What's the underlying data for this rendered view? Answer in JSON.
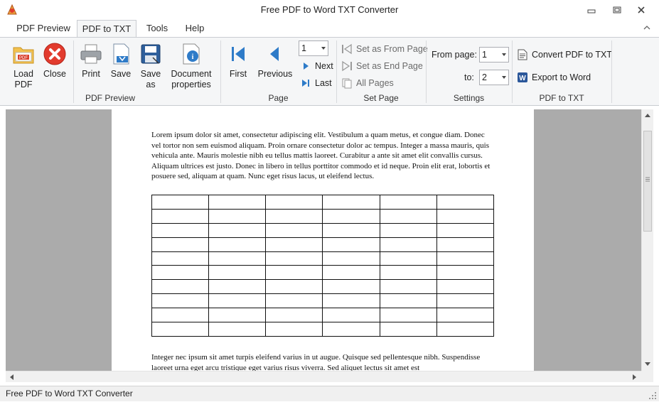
{
  "window": {
    "title": "Free PDF to Word TXT Converter"
  },
  "tabs": [
    {
      "label": "PDF Preview"
    },
    {
      "label": "PDF to TXT"
    },
    {
      "label": "Tools"
    },
    {
      "label": "Help"
    }
  ],
  "active_tab": "PDF to TXT",
  "ribbon": {
    "pdf_preview_group": {
      "label": "PDF Preview",
      "load": {
        "line1": "Load",
        "line2": "PDF"
      },
      "close": "Close",
      "print": "Print",
      "save": "Save",
      "save_as": {
        "line1": "Save",
        "line2": "as"
      },
      "doc_props": {
        "line1": "Document",
        "line2": "properties"
      }
    },
    "page_group": {
      "label": "Page",
      "first": "First",
      "previous": "Previous",
      "page_value": "1",
      "next": "Next",
      "last": "Last"
    },
    "set_page_group": {
      "label": "Set Page",
      "set_from": "Set as From Page",
      "set_end": "Set as End Page",
      "all_pages": "All Pages"
    },
    "settings_group": {
      "label": "Settings",
      "from_label": "From page:",
      "from_value": "1",
      "to_label": "to:",
      "to_value": "2"
    },
    "pdf_to_txt_group": {
      "label": "PDF to TXT",
      "convert": "Convert PDF to TXT",
      "export": "Export to Word"
    }
  },
  "document": {
    "paragraph1": "Lorem ipsum dolor sit amet, consectetur adipiscing elit. Vestibulum a quam metus, et congue diam. Donec vel tortor non sem euismod aliquam. Proin ornare consectetur dolor ac tempus. Integer a massa mauris, quis vehicula ante. Mauris molestie nibh eu tellus mattis laoreet. Curabitur a ante sit amet elit convallis cursus. Aliquam ultrices est justo. Donec in libero in tellus porttitor commodo et id neque. Proin elit erat, lobortis et posuere sed, aliquam at quam. Nunc eget risus lacus, ut eleifend lectus.",
    "table": {
      "rows": 10,
      "cols": 6
    },
    "paragraph2": "Integer nec ipsum sit amet turpis eleifend varius in ut augue. Quisque sed pellentesque nibh. Suspendisse laoreet urna eget arcu tristique eget varius risus viverra. Sed aliquet lectus sit amet est"
  },
  "status": {
    "text": "Free PDF to Word TXT Converter"
  },
  "colors": {
    "accent_blue": "#2e7bc8",
    "close_red": "#e23b2e",
    "pdf_orange": "#e9a23b",
    "viewer_gray": "#ababab"
  },
  "icons": [
    "app-icon",
    "minimize-icon",
    "restore-icon",
    "close-icon",
    "collapse-ribbon-icon",
    "load-pdf-icon",
    "close-pdf-icon",
    "printer-icon",
    "save-icon",
    "save-as-icon",
    "document-properties-icon",
    "first-page-icon",
    "previous-page-icon",
    "next-page-icon",
    "last-page-icon",
    "set-from-icon",
    "set-end-icon",
    "all-pages-icon",
    "txt-file-icon",
    "word-icon"
  ]
}
